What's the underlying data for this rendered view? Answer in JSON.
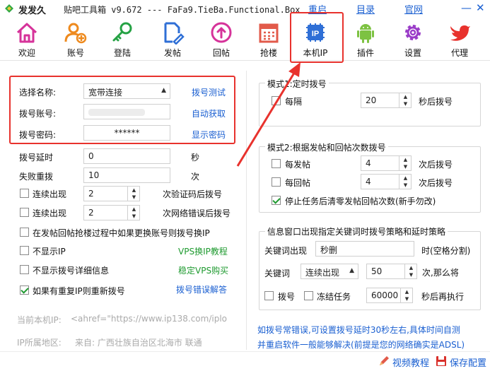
{
  "title": {
    "app_name": "发发久",
    "subtitle": "贴吧工具箱 v9.672 --- FaFa9.TieBa.Functional.Box",
    "links": [
      "重启",
      "目录",
      "官网"
    ],
    "minimize": "—",
    "close": "✕"
  },
  "toolbar": [
    {
      "label": "欢迎",
      "icon": "home-icon"
    },
    {
      "label": "账号",
      "icon": "user-add-icon"
    },
    {
      "label": "登陆",
      "icon": "key-icon"
    },
    {
      "label": "发帖",
      "icon": "edit-document-icon"
    },
    {
      "label": "回帖",
      "icon": "reply-icon"
    },
    {
      "label": "抢楼",
      "icon": "calendar-icon"
    },
    {
      "label": "本机IP",
      "icon": "ip-icon"
    },
    {
      "label": "插件",
      "icon": "android-icon"
    },
    {
      "label": "设置",
      "icon": "gear-icon"
    },
    {
      "label": "代理",
      "icon": "bird-icon"
    }
  ],
  "dial": {
    "name_label": "选择名称:",
    "name_value": "宽带连接",
    "name_action": "拨号测试",
    "account_label": "拨号账号:",
    "account_action": "自动获取",
    "password_label": "拨号密码:",
    "password_value": "******",
    "password_action": "显示密码"
  },
  "left": {
    "delay_label": "拨号延时",
    "delay_value": "0",
    "delay_unit": "秒",
    "retry_label": "失败重拨",
    "retry_value": "10",
    "retry_unit": "次",
    "consec1_label": "连续出现",
    "consec1_value": "2",
    "consec1_suffix": "次验证码后拨号",
    "consec2_label": "连续出现",
    "consec2_value": "2",
    "consec2_suffix": "次网络错误后拨号",
    "switch_label": "在发帖回帖抢楼过程中如果更换账号则拨号换IP",
    "hide_ip_label": "不显示IP",
    "vps_tutorial": "VPS换IP教程",
    "hide_info_label": "不显示拨号详细信息",
    "vps_buy": "稳定VPS购买",
    "redial_label": "如果有重复IP则重新拨号",
    "dial_error": "拨号错误解答"
  },
  "status": {
    "ip_label": "当前本机IP:",
    "ip_value": "<ahref=\"https://www.ip138.com/iplo",
    "region_label": "IP所属地区:",
    "region_value": "来自: 广西壮族自治区北海市 联通"
  },
  "mode1": {
    "title": "模式1:定时拨号",
    "every_label": "每隔",
    "every_value": "20",
    "every_suffix": "秒后拨号"
  },
  "mode2": {
    "title": "模式2:根据发帖和回帖次数拨号",
    "post_label": "每发帖",
    "post_value": "4",
    "post_suffix": "次后拨号",
    "reply_label": "每回帖",
    "reply_value": "4",
    "reply_suffix": "次后拨号",
    "clear_label": "停止任务后清零发帖回帖次数(新手勿改)"
  },
  "keyword": {
    "title": "信息窗口出现指定关键词时拨号策略和延时策略",
    "appear_label": "关键词出现",
    "appear_value": "秒删",
    "appear_hint": "时(空格分割)",
    "kw_label": "关键词",
    "kw_mode": "连续出现",
    "kw_count": "50",
    "kw_suffix": "次,那么将",
    "dial_label": "拨号",
    "freeze_label": "冻结任务",
    "freeze_value": "60000",
    "freeze_suffix": "秒后再执行"
  },
  "tip": {
    "line1": "如拨号常错误,可设置拨号延时30秒左右,具体时间自测",
    "line2": "并重启软件一般能够解决(前提是您的网络确实是ADSL)"
  },
  "bottom": {
    "video": "视频教程",
    "save": "保存配置"
  },
  "colors": {
    "accent": "#1a5fd1",
    "highlight": "#e8322d",
    "green": "#1e9a2f"
  }
}
